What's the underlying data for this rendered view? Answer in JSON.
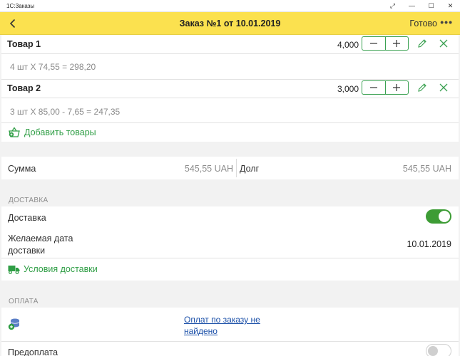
{
  "window": {
    "title": "1С:Заказы",
    "buttons": [
      "⤢",
      "—",
      "☐",
      "✕"
    ]
  },
  "header": {
    "title": "Заказ №1 от 10.01.2019",
    "done_label": "Готово",
    "more": "•••"
  },
  "items": [
    {
      "title": "Товар 1",
      "qty": "4,000",
      "calc": "4 шт X 74,55  = 298,20"
    },
    {
      "title": "Товар 2",
      "qty": "3,000",
      "calc": "3 шт X 85,00  - 7,65 = 247,35"
    }
  ],
  "add_goods_label": "Добавить товары",
  "totals": {
    "sum_label": "Сумма",
    "sum_value": "545,55 UAH",
    "debt_label": "Долг",
    "debt_value": "545,55 UAH"
  },
  "delivery": {
    "section_title": "ДОСТАВКА",
    "delivery_label": "Доставка",
    "delivery_on": true,
    "date_label_line1": "Желаемая дата",
    "date_label_line2": "доставки",
    "date_value": "10.01.2019",
    "terms_label": "Условия доставки"
  },
  "payment": {
    "section_title": "ОПЛАТА",
    "link_line1": "Оплат по заказу не",
    "link_line2": "найдено",
    "prepay_label": "Предоплата",
    "prepay_on": false
  },
  "colors": {
    "header_yellow": "#fbe14f",
    "accent_green": "#3aa151",
    "link_blue": "#1a4fa8"
  }
}
